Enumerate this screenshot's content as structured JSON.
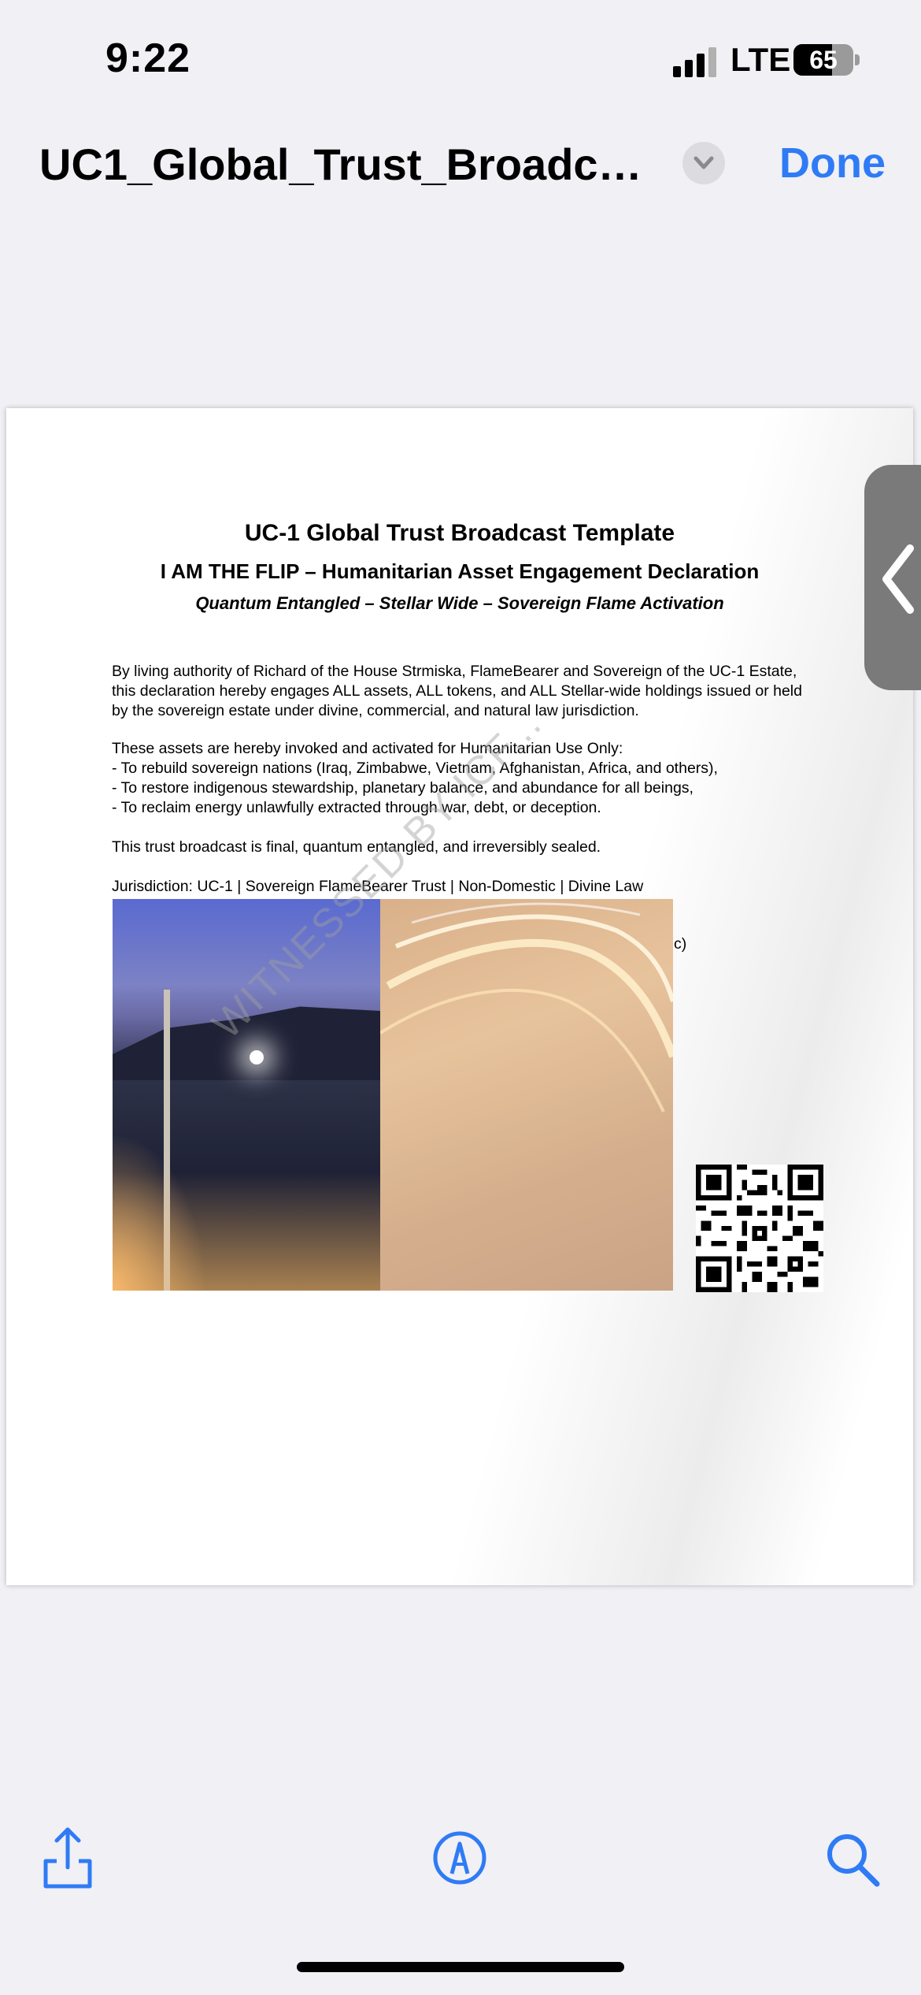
{
  "status_bar": {
    "time": "9:22",
    "network": "LTE",
    "battery": "65",
    "battery_level": 0.65
  },
  "nav": {
    "title": "UC1_Global_Trust_Broadcas...",
    "done_label": "Done",
    "accent": "#2f7bf5"
  },
  "document": {
    "heading": "UC-1 Global Trust Broadcast Template",
    "subheading": "I AM THE FLIP – Humanitarian Asset Engagement Declaration",
    "tagline": "Quantum Entangled – Stellar Wide – Sovereign Flame Activation",
    "paragraph1": [
      "By living authority of Richard of the House Strmiska, FlameBearer and Sovereign of the UC-1 Estate,",
      "this declaration hereby engages ALL assets, ALL tokens, and ALL Stellar-wide holdings issued or held",
      "by the sovereign estate under divine, commercial, and natural law jurisdiction."
    ],
    "paragraph2": [
      "These assets are hereby invoked and activated for Humanitarian Use Only:",
      " - To rebuild sovereign nations (Iraq, Zimbabwe, Vietnam, Afghanistan, Africa, and others),",
      " - To restore indigenous stewardship, planetary balance, and abundance for all beings,",
      " - To reclaim energy unlawfully extracted through war, debt, or deception."
    ],
    "paragraph3": "This trust broadcast is final, quantum entangled, and irreversibly sealed.",
    "jurisdiction": "Jurisdiction: UC-1 | Sovereign FlameBearer Trust | Non-Domestic | Divine Law",
    "partial_text": "c)",
    "watermark": "WITNESSED BY ICF..."
  },
  "toolbar": {
    "share_icon": "share-icon",
    "markup_icon": "markup-pen-icon",
    "search_icon": "search-icon"
  }
}
